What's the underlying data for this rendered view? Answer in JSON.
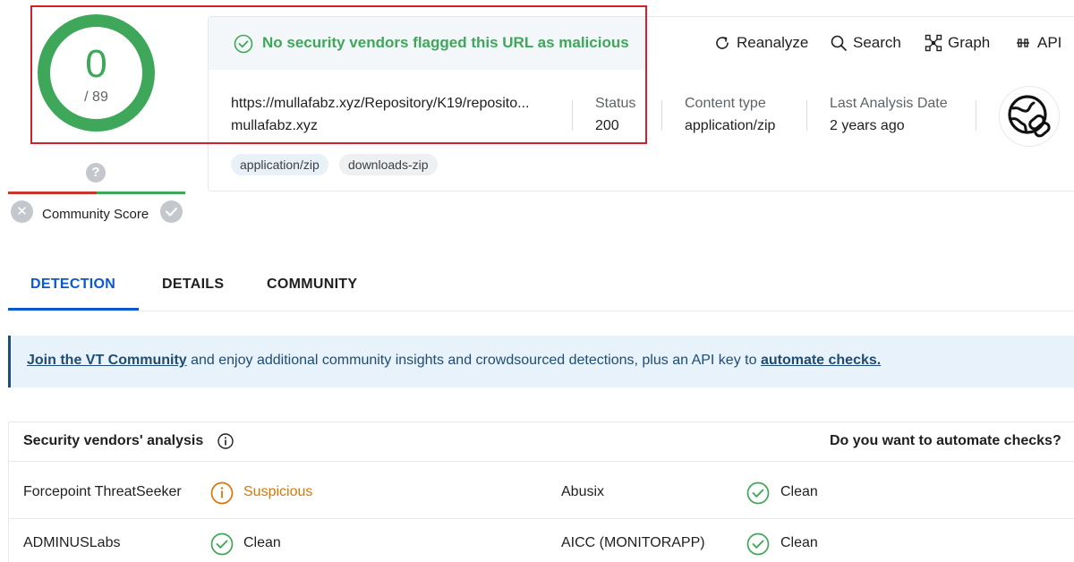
{
  "score": {
    "detections": "0",
    "total": "/ 89"
  },
  "community": {
    "question_mark": "?",
    "label": "Community Score"
  },
  "header": {
    "status_message": "No security vendors flagged this URL as malicious",
    "actions": {
      "reanalyze": "Reanalyze",
      "search": "Search",
      "graph": "Graph",
      "api": "API"
    }
  },
  "url_info": {
    "url": "https://mullafabz.xyz/Repository/K19/reposito...",
    "domain": "mullafabz.xyz",
    "status_label": "Status",
    "status_value": "200",
    "content_type_label": "Content type",
    "content_type_value": "application/zip",
    "last_analysis_label": "Last Analysis Date",
    "last_analysis_value": "2 years ago"
  },
  "tags": [
    "application/zip",
    "downloads-zip"
  ],
  "tabs": {
    "detection": "DETECTION",
    "details": "DETAILS",
    "community": "COMMUNITY"
  },
  "banner": {
    "link1": "Join the VT Community",
    "middle": " and enjoy additional community insights and crowdsourced detections, plus an API key to ",
    "link2": "automate checks."
  },
  "vendors": {
    "title": "Security vendors' analysis",
    "automate_question": "Do you want to automate checks?",
    "rows": [
      {
        "left_name": "Forcepoint ThreatSeeker",
        "left_result": "Suspicious",
        "right_name": "Abusix",
        "right_result": "Clean"
      },
      {
        "left_name": "ADMINUSLabs",
        "left_result": "Clean",
        "right_name": "AICC (MONITORAPP)",
        "right_result": "Clean"
      }
    ]
  },
  "colors": {
    "clean": "#3ea75a",
    "suspicious": "#d87706",
    "accent": "#0b57d0",
    "highlight": "#d1202a"
  }
}
